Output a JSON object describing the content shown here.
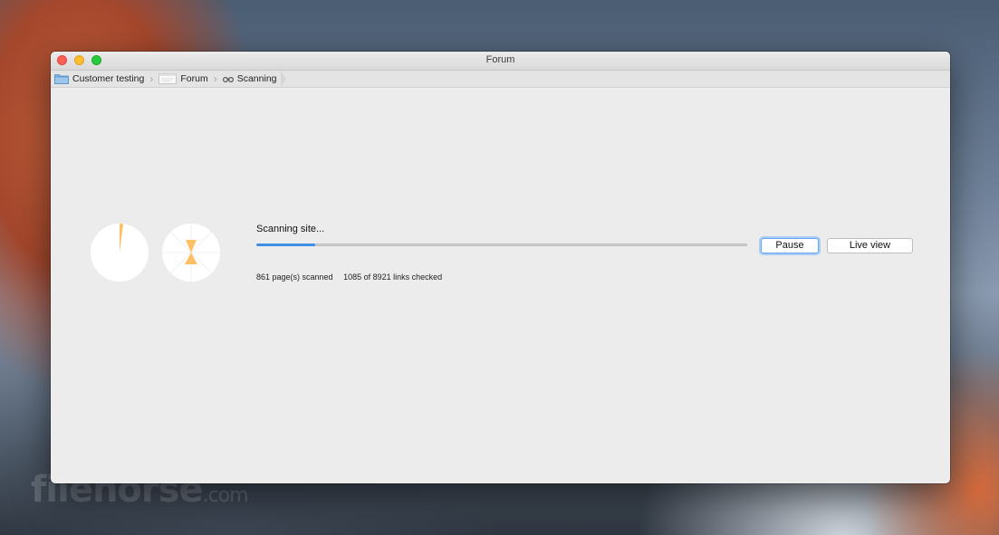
{
  "window": {
    "title": "Forum"
  },
  "breadcrumb": [
    {
      "label": "Customer testing",
      "icon": "folder-icon"
    },
    {
      "label": "Forum",
      "icon": "document-icon"
    },
    {
      "label": "Scanning",
      "icon": "binoculars-icon"
    }
  ],
  "scan": {
    "status": "Scanning site...",
    "progress_fraction": 0.12,
    "pages_scanned": "861 page(s) scanned",
    "links_checked": "1085 of 8921 links checked"
  },
  "buttons": {
    "pause": "Pause",
    "live_view": "Live view"
  },
  "watermark": {
    "text": "filehorse",
    "suffix": ".com"
  },
  "colors": {
    "accent": "#3f8ee6",
    "pie_fill": "#ffc065",
    "pie_bg": "#ffffff"
  }
}
